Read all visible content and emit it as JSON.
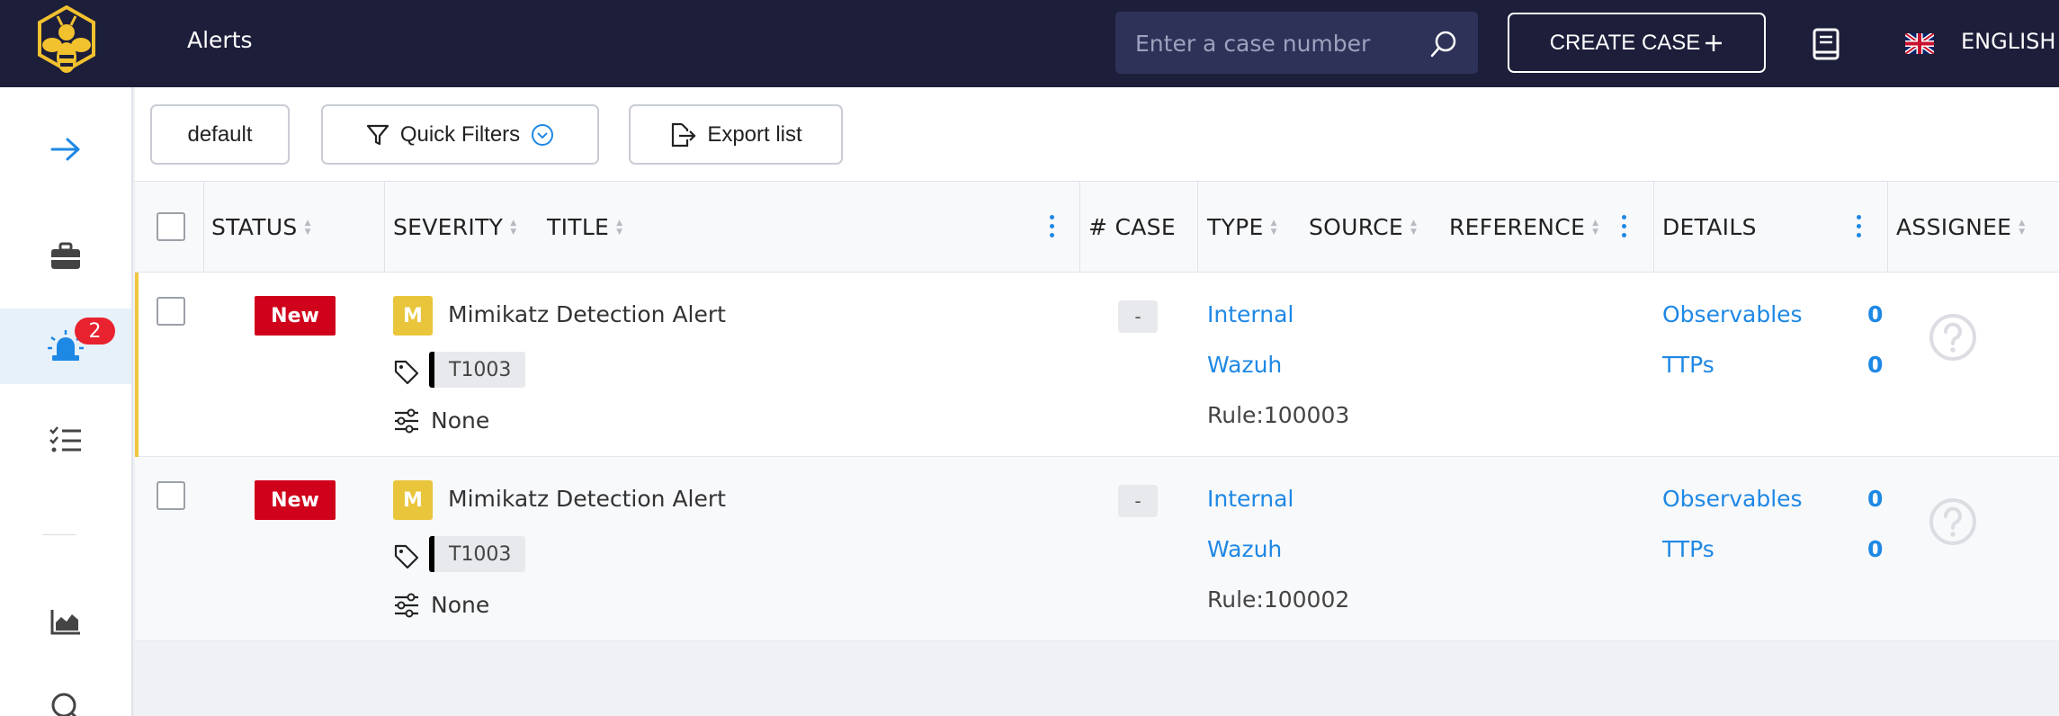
{
  "header": {
    "page_title": "Alerts",
    "search_placeholder": "Enter a case number",
    "create_case_label": "CREATE CASE",
    "language": "ENGLISH"
  },
  "sidebar": {
    "alerts_badge": "2"
  },
  "toolbar": {
    "default_label": "default",
    "quick_filters_label": "Quick Filters",
    "export_label": "Export list"
  },
  "table": {
    "columns": {
      "status": "STATUS",
      "severity": "SEVERITY",
      "title": "TITLE",
      "case": "# CASE",
      "type": "TYPE",
      "source": "SOURCE",
      "reference": "REFERENCE",
      "details": "DETAILS",
      "assignee": "ASSIGNEE"
    },
    "rows": [
      {
        "status": "New",
        "severity": "M",
        "title": "Mimikatz Detection Alert",
        "tag": "T1003",
        "custom_fields": "None",
        "case": "-",
        "type": "Internal",
        "source": "Wazuh",
        "reference": "Rule:100003",
        "observables_label": "Observables",
        "observables_count": "0",
        "ttps_label": "TTPs",
        "ttps_count": "0"
      },
      {
        "status": "New",
        "severity": "M",
        "title": "Mimikatz Detection Alert",
        "tag": "T1003",
        "custom_fields": "None",
        "case": "-",
        "type": "Internal",
        "source": "Wazuh",
        "reference": "Rule:100002",
        "observables_label": "Observables",
        "observables_count": "0",
        "ttps_label": "TTPs",
        "ttps_count": "0"
      }
    ]
  },
  "colors": {
    "topbar": "#1d1e3a",
    "accent": "#1e88e5",
    "status_new": "#d0021b",
    "severity_medium": "#e9c53b"
  }
}
